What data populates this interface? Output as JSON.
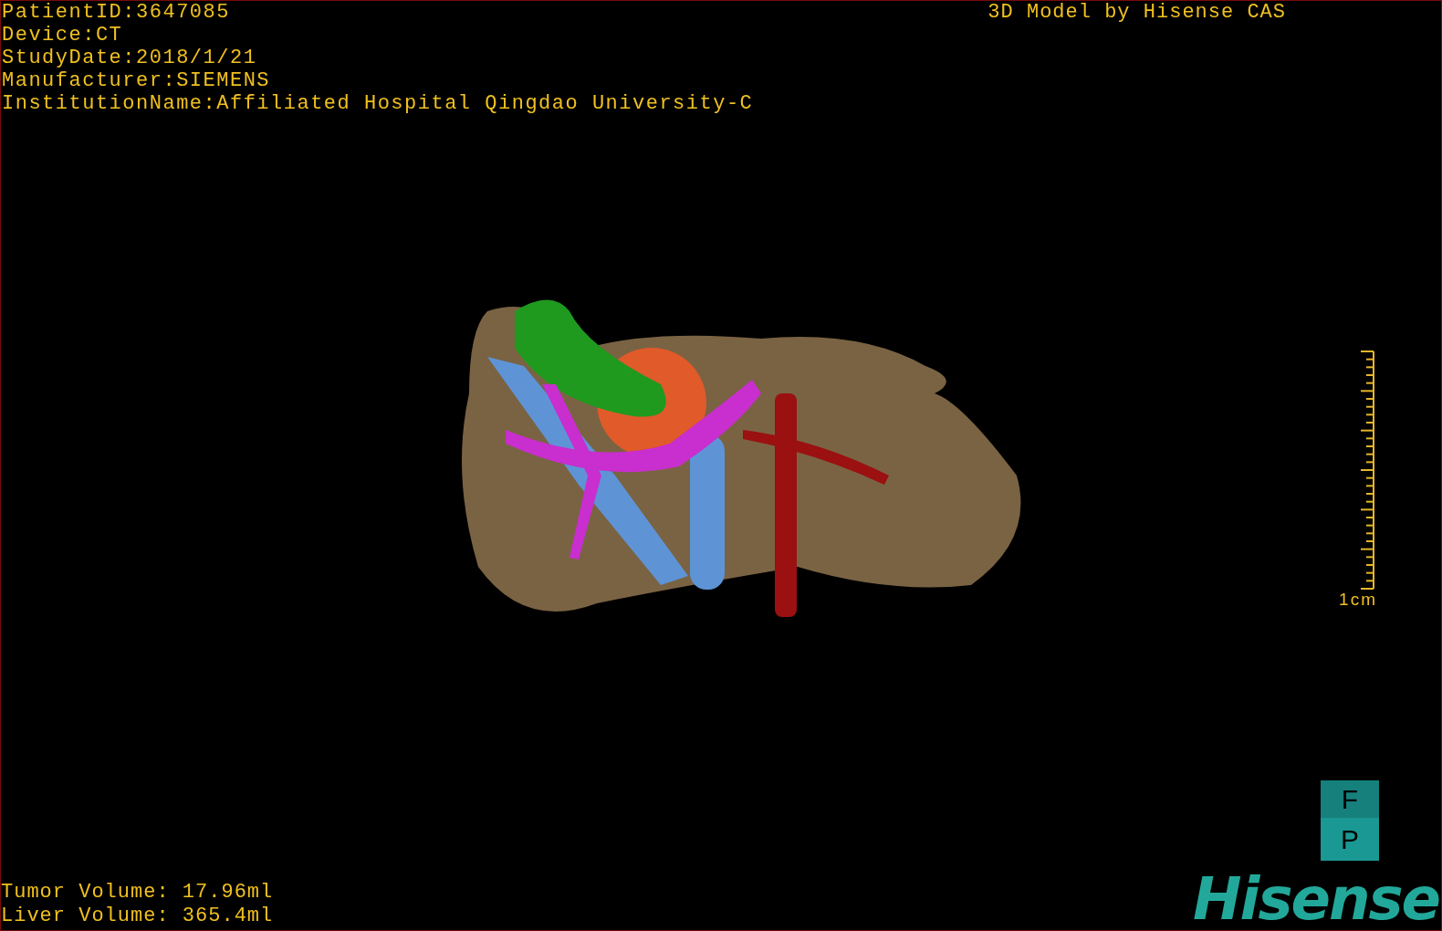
{
  "patient_info": [
    "PatientID:3647085",
    "Device:CT",
    "StudyDate:2018/1/21",
    "Manufacturer:SIEMENS",
    "InstitutionName:Affiliated Hospital Qingdao University-C"
  ],
  "title": "3D Model by Hisense CAS",
  "scale_bar": {
    "label": "1cm"
  },
  "orientation": {
    "top": "F",
    "bottom": "P"
  },
  "volumes": [
    "Tumor Volume: 17.96ml",
    "Liver Volume: 365.4ml"
  ],
  "logo": "Hisense"
}
